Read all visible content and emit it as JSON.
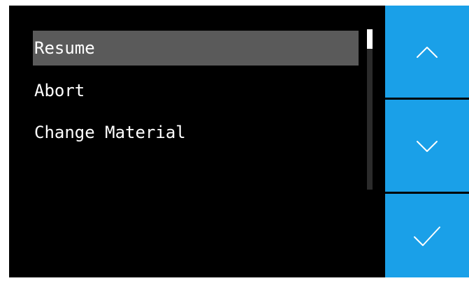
{
  "menu": {
    "items": [
      {
        "label": "Resume",
        "selected": true
      },
      {
        "label": "Abort",
        "selected": false
      },
      {
        "label": "Change Material",
        "selected": false
      }
    ],
    "scroll_position": 0
  },
  "buttons": {
    "up_icon": "chevron-up-icon",
    "down_icon": "chevron-down-icon",
    "confirm_icon": "checkmark-icon"
  },
  "colors": {
    "background": "#000000",
    "selection": "#5a5a5a",
    "accent": "#1aa0e8",
    "text": "#ffffff"
  }
}
